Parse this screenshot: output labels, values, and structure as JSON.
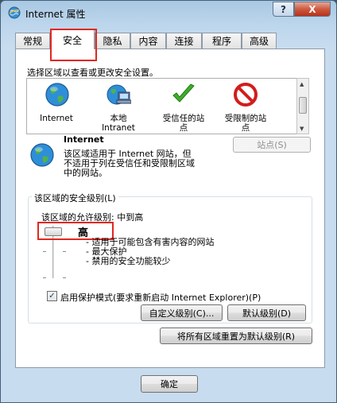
{
  "window": {
    "title": "Internet 属性",
    "help_glyph": "?",
    "close_glyph": "X"
  },
  "tabs": [
    {
      "label": "常规"
    },
    {
      "label": "安全"
    },
    {
      "label": "隐私"
    },
    {
      "label": "内容"
    },
    {
      "label": "连接"
    },
    {
      "label": "程序"
    },
    {
      "label": "高级"
    }
  ],
  "security": {
    "instruction": "选择区域以查看或更改安全设置。",
    "zones": [
      {
        "name": "Internet",
        "icon": "globe-icon"
      },
      {
        "name": "本地 Intranet",
        "line1": "本地",
        "line2": "Intranet",
        "icon": "intranet-icon"
      },
      {
        "name": "受信任的站点",
        "line1": "受信任的站",
        "line2": "点",
        "icon": "check-icon"
      },
      {
        "name": "受限制的站点",
        "line1": "受限制的站",
        "line2": "点",
        "icon": "restricted-icon"
      }
    ],
    "selected_zone": {
      "title": "Internet",
      "desc_line1": "该区域适用于 Internet 网站，但",
      "desc_line2": "不适用于列在受信任和受限制区域",
      "desc_line3": "中的网站。"
    },
    "sites_button": "站点(S)",
    "level_group_title": "该区域的安全级别(L)",
    "allowed_levels": "该区域的允许级别: 中到高",
    "current_level": "高",
    "level_desc": [
      "- 适用于可能包含有害内容的网站",
      "- 最大保护",
      "- 禁用的安全功能较少"
    ],
    "protected_mode_label": "启用保护模式(要求重新启动 Internet Explorer)(P)",
    "protected_mode_checked": true,
    "check_glyph": "✓",
    "custom_level_button": "自定义级别(C)...",
    "default_level_button": "默认级别(D)",
    "reset_all_button": "将所有区域重置为默认级别(R)"
  },
  "footer": {
    "ok_button": "确定"
  },
  "colors": {
    "title_bar": "#bcd6ec",
    "highlight_box": "#e0281f",
    "background": "#3d5566"
  }
}
